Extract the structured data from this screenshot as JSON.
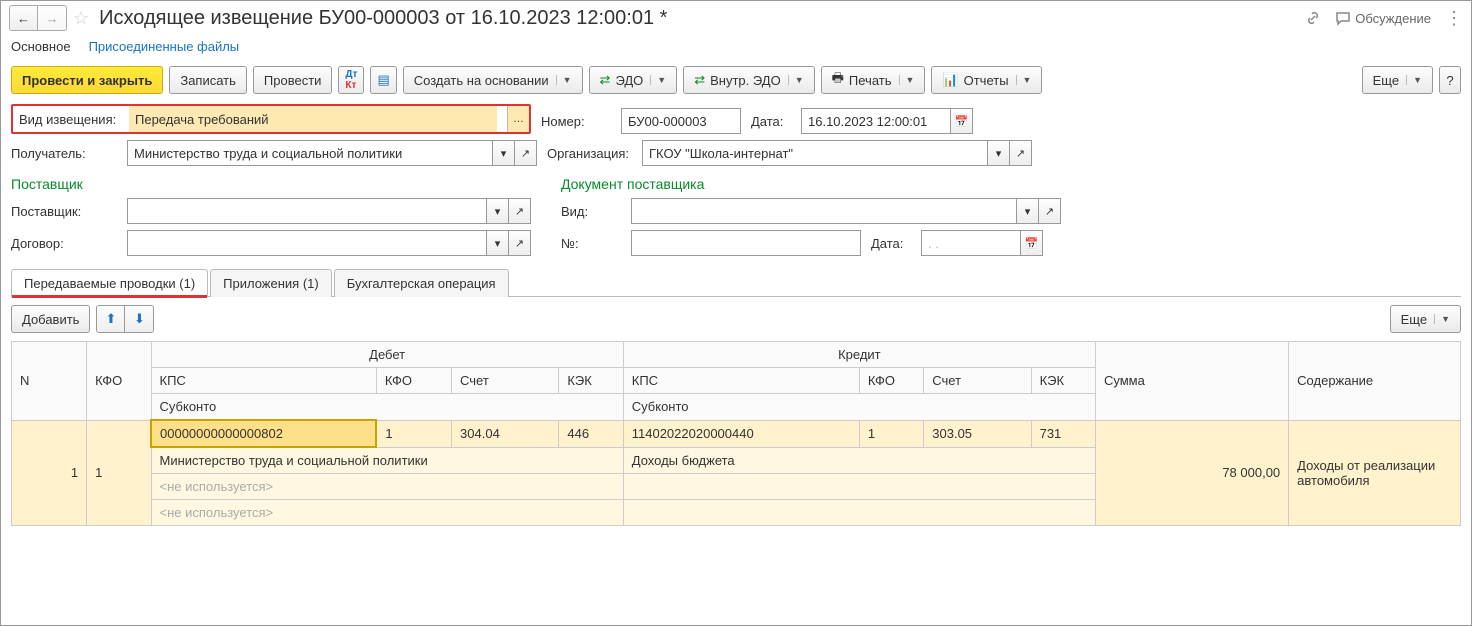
{
  "header": {
    "title": "Исходящее извещение БУ00-000003 от 16.10.2023 12:00:01 *",
    "discuss": "Обсуждение"
  },
  "nav": {
    "main": "Основное",
    "files": "Присоединенные файлы"
  },
  "toolbar": {
    "post_close": "Провести и закрыть",
    "save": "Записать",
    "post": "Провести",
    "create_based": "Создать на основании",
    "edo": "ЭДО",
    "int_edo": "Внутр. ЭДО",
    "print": "Печать",
    "reports": "Отчеты",
    "more": "Еще"
  },
  "form": {
    "notice_type_lbl": "Вид извещения:",
    "notice_type": "Передача требований",
    "number_lbl": "Номер:",
    "number": "БУ00-000003",
    "date_lbl": "Дата:",
    "date": "16.10.2023 12:00:01",
    "recipient_lbl": "Получатель:",
    "recipient": "Министерство труда и социальной политики",
    "org_lbl": "Организация:",
    "org": "ГКОУ \"Школа-интернат\"",
    "supplier_section": "Поставщик",
    "supplier_lbl": "Поставщик:",
    "contract_lbl": "Договор:",
    "doc_section": "Документ поставщика",
    "kind_lbl": "Вид:",
    "no_lbl": "№:",
    "doc_date_lbl": "Дата:",
    "doc_date_placeholder": ".  ."
  },
  "tabs": {
    "t1": "Передаваемые проводки (1)",
    "t2": "Приложения (1)",
    "t3": "Бухгалтерская операция"
  },
  "tbl": {
    "add": "Добавить",
    "more": "Еще",
    "h_n": "N",
    "h_kfo": "КФО",
    "h_debit": "Дебет",
    "h_credit": "Кредит",
    "h_sum": "Сумма",
    "h_content": "Содержание",
    "h_kps": "КПС",
    "h_acc": "Счет",
    "h_kek": "КЭК",
    "h_sub": "Субконто"
  },
  "row": {
    "n": "1",
    "kfo": "1",
    "d_kps": "00000000000000802",
    "d_kfo": "1",
    "d_acc": "304.04",
    "d_kek": "446",
    "c_kps": "11402022020000440",
    "c_kfo": "1",
    "c_acc": "303.05",
    "c_kek": "731",
    "sum": "78 000,00",
    "content": "Доходы от реализации автомобиля",
    "d_sub1": "Министерство труда и социальной политики",
    "c_sub1": "Доходы бюджета",
    "notused": "<не используется>"
  }
}
